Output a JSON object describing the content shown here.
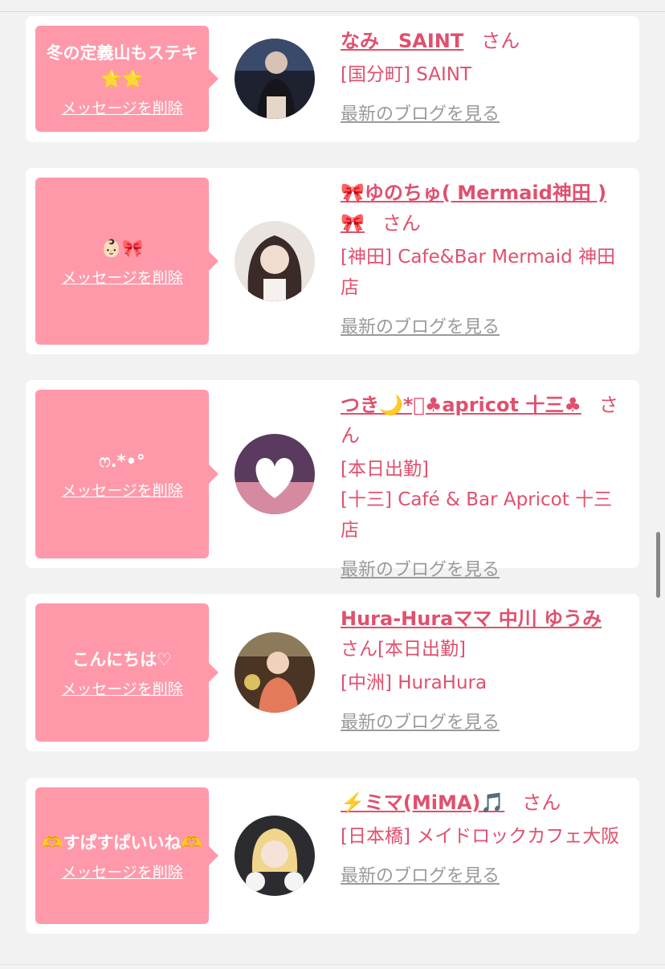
{
  "delete_label": "メッセージを削除",
  "blog_label": "最新のブログを見る",
  "san_label": "さん",
  "colors": {
    "accent": "#e0506e",
    "bubble": "#ff99aa",
    "link_gray": "#9a9a9a"
  },
  "cards": [
    {
      "message": "冬の定義山もステキ🌟🌟",
      "name": "なみ　SAINT",
      "tag": "",
      "shop": "[国分町] SAINT"
    },
    {
      "message": "👶🏻🎀",
      "name": "🎀ゆのちゅ( Mermaid神田 )🎀",
      "tag": "",
      "shop": "[神田] Cafe&Bar Mermaid 神田店"
    },
    {
      "message": "ෆ.*•°",
      "name": "つき🌙*ﾟ♣apricot 十三♣",
      "tag": "[本日出勤]",
      "shop": "[十三] Café & Bar Apricot 十三店"
    },
    {
      "message": "こんにちは♡",
      "name": "Hura-Huraママ 中川 ゆうみ",
      "tag": "[本日出勤]",
      "shop": "[中洲] HuraHura"
    },
    {
      "message": "🫶すぱすぱいいね🫶",
      "name": "⚡️ミマ(MiMA)🎵",
      "tag": "",
      "shop": "[日本橋] メイドロックカフェ大阪"
    }
  ]
}
